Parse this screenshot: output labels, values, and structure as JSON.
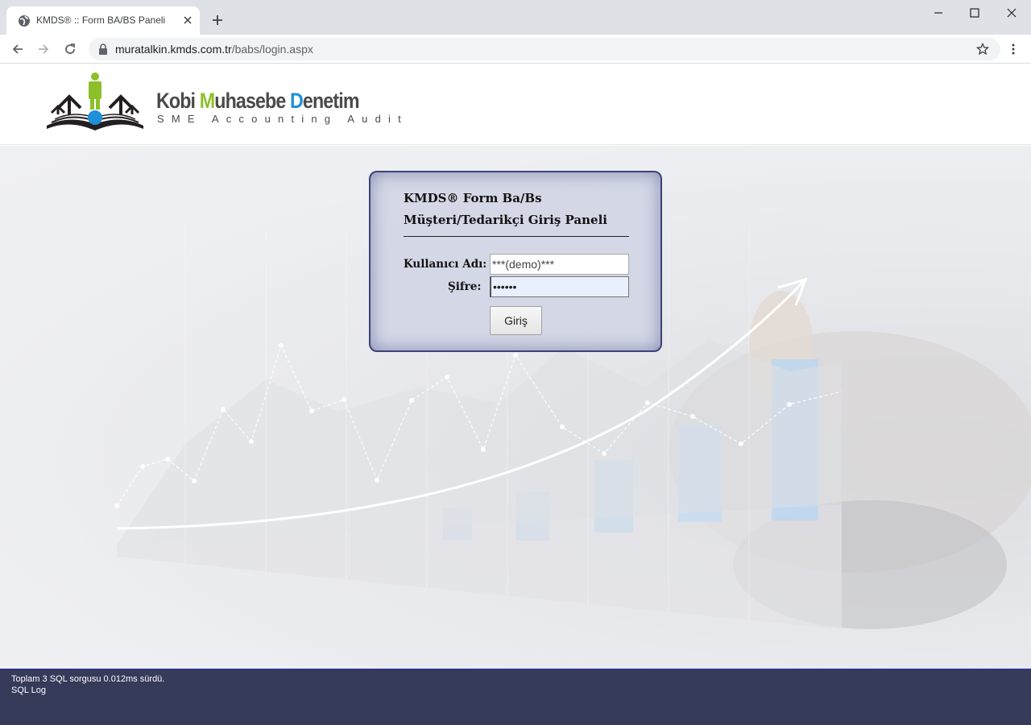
{
  "browser": {
    "tab_title": "KMDS® :: Form BA/BS Paneli",
    "url_host": "muratalkin.kmds.com.tr",
    "url_path": "/babs/login.aspx"
  },
  "header": {
    "logo_word1_initial": "K",
    "logo_word1_rest": "obi ",
    "logo_word2_initial": "M",
    "logo_word2_rest": "uhasebe ",
    "logo_word3_initial": "D",
    "logo_word3_rest": "enetim",
    "logo_subtitle": "SME Accounting Audit",
    "colors": {
      "green": "#8dbf2a",
      "blue": "#1e90d8",
      "dark": "#231f20"
    }
  },
  "login": {
    "title_line1": "KMDS® Form Ba/Bs",
    "title_line2": "Müşteri/Tedarikçi Giriş Paneli",
    "username_label": "Kullanıcı Adı:",
    "username_value": "***(demo)***",
    "password_label": "Şifre:",
    "password_value": "••••••",
    "submit_label": "Giriş",
    "colors": {
      "panel_border": "#3b4377"
    }
  },
  "footer": {
    "sql_summary": "Toplam 3 SQL sorgusu 0.012ms sürdü.",
    "sql_log_link": "SQL Log",
    "colors": {
      "background": "#363b5a"
    }
  }
}
